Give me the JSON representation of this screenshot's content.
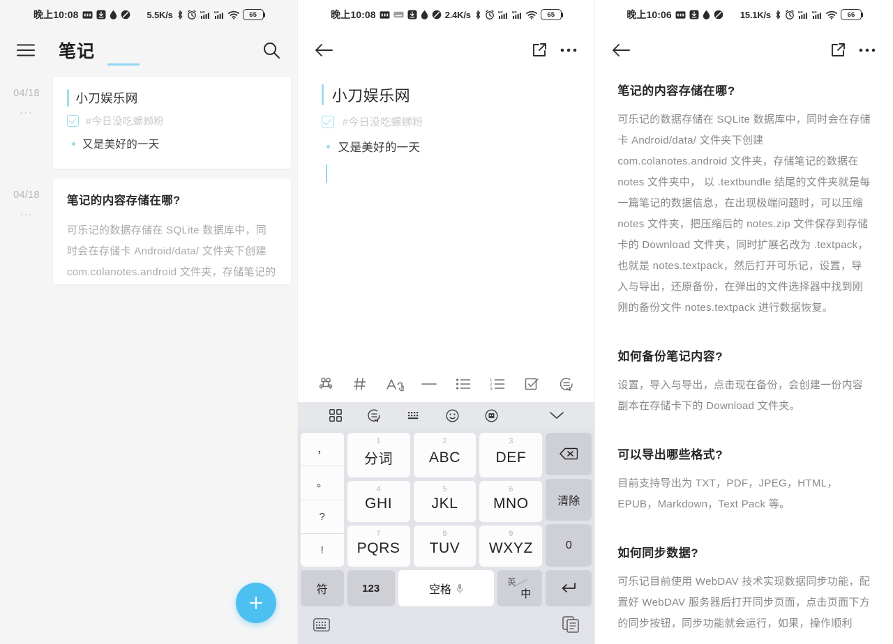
{
  "panels": [
    {
      "statusbar": {
        "time": "晚上10:08",
        "netspeed": "5.5K/s",
        "battery": "65",
        "icons": [
          "sms-icon",
          "download-icon",
          "water-drop-icon",
          "mute-icon",
          "bluetooth-icon",
          "alarm-icon",
          "signal-1-icon",
          "signal-2-icon",
          "wifi-icon",
          "battery-icon"
        ]
      },
      "appbar": {
        "title": "笔记",
        "menu_icon": "hamburger-menu-icon",
        "search_icon": "search-icon"
      },
      "notes": [
        {
          "date": "04/18",
          "more": "...",
          "title": "小刀娱乐网",
          "tag": "#今日没吃螺蛳粉",
          "bullet": "又是美好的一天"
        },
        {
          "date": "04/18",
          "more": "...",
          "heading": "笔记的内容存储在哪?",
          "body": "可乐记的数据存储在 SQLite 数据库中，同时会在存储卡 Android/data/ 文件夹下创建 com.colanotes.android 文件夹，存储笔记的"
        }
      ],
      "fab": {
        "label": "+",
        "color": "#4cc0f0",
        "name": "add-note-fab"
      }
    },
    {
      "statusbar": {
        "time": "晚上10:08",
        "netspeed": "2.4K/s",
        "battery": "65"
      },
      "appbar": {
        "back_icon": "back-arrow-icon",
        "share_icon": "share-export-icon",
        "more_icon": "more-options-icon"
      },
      "editor": {
        "title": "小刀娱乐网",
        "tag": "#今日没吃螺蛳粉",
        "bullet": "又是美好的一天"
      },
      "md_toolbar": [
        {
          "name": "command-icon",
          "glyph": "⌘"
        },
        {
          "name": "heading-hash-icon",
          "glyph": "#"
        },
        {
          "name": "font-size-icon",
          "glyph": "Aa"
        },
        {
          "name": "horizontal-rule-icon",
          "glyph": "—"
        },
        {
          "name": "bullet-list-icon",
          "glyph": "list"
        },
        {
          "name": "numbered-list-icon",
          "glyph": "numlist"
        },
        {
          "name": "checkbox-list-icon",
          "glyph": "check"
        },
        {
          "name": "quote-icon",
          "glyph": "quote"
        }
      ],
      "ime_bar": [
        {
          "name": "apps-grid-icon"
        },
        {
          "name": "clipboard-chat-icon"
        },
        {
          "name": "keyboard-layout-icon"
        },
        {
          "name": "emoji-icon"
        },
        {
          "name": "theme-skin-icon"
        },
        {
          "name": "collapse-keyboard-chevron-icon"
        }
      ],
      "keyboard": {
        "symbol_keys": [
          "，",
          "。",
          "?",
          "!"
        ],
        "number_keys": [
          {
            "sup": "1",
            "label": "分词"
          },
          {
            "sup": "2",
            "label": "ABC"
          },
          {
            "sup": "3",
            "label": "DEF"
          },
          {
            "sup": "4",
            "label": "GHI"
          },
          {
            "sup": "5",
            "label": "JKL"
          },
          {
            "sup": "6",
            "label": "MNO"
          },
          {
            "sup": "7",
            "label": "PQRS"
          },
          {
            "sup": "8",
            "label": "TUV"
          },
          {
            "sup": "9",
            "label": "WXYZ"
          }
        ],
        "action_keys": [
          {
            "name": "backspace-key",
            "label": "⌫"
          },
          {
            "name": "clear-key",
            "label": "清除"
          },
          {
            "name": "zero-key",
            "label": "0"
          }
        ],
        "bottom_row": {
          "symbols": "符",
          "numbers": "123",
          "space": "空格",
          "lang_en": "英",
          "lang_cn": "中",
          "enter": "↵"
        },
        "footer": {
          "keyboard_switch_icon": "keyboard-switch-icon",
          "clipboard_icon": "clipboard-history-icon"
        }
      }
    },
    {
      "statusbar": {
        "time": "晚上10:06",
        "netspeed": "15.1K/s",
        "battery": "66"
      },
      "appbar": {
        "back_icon": "back-arrow-icon",
        "share_icon": "share-export-icon",
        "more_icon": "more-options-icon"
      },
      "faq": [
        {
          "heading": "笔记的内容存储在哪?",
          "body": "可乐记的数据存储在 SQLite 数据库中，同时会在存储卡 Android/data/ 文件夹下创建 com.colanotes.android 文件夹，存储笔记的数据在 notes 文件夹中， 以 .textbundle 结尾的文件夹就是每一篇笔记的数据信息，在出现极端问题时，可以压缩 notes 文件夹，把压缩后的 notes.zip 文件保存到存储卡的 Download 文件夹，同时扩展名改为 .textpack，也就是 notes.textpack，然后打开可乐记，设置，导入与导出，还原备份，在弹出的文件选择器中找到刚刚的备份文件 notes.textpack 进行数据恢复。"
        },
        {
          "heading": "如何备份笔记内容?",
          "body": "设置，导入与导出，点击现在备份，会创建一份内容副本在存储卡下的 Download 文件夹。"
        },
        {
          "heading": "可以导出哪些格式?",
          "body": "目前支持导出为 TXT，PDF，JPEG，HTML，EPUB，Markdown，Text Pack 等。"
        },
        {
          "heading": "如何同步数据?",
          "body": "可乐记目前使用 WebDAV 技术实现数据同步功能，配置好 WebDAV 服务器后打开同步页面，点击页面下方的同步按钮，同步功能就会运行，如果，操作顺利"
        }
      ]
    }
  ],
  "colors": {
    "accent": "#4cc0f0",
    "tint": "#9ddcef",
    "panel_bg": "#f5f5f6",
    "key_bg": "#cfd0d6"
  }
}
